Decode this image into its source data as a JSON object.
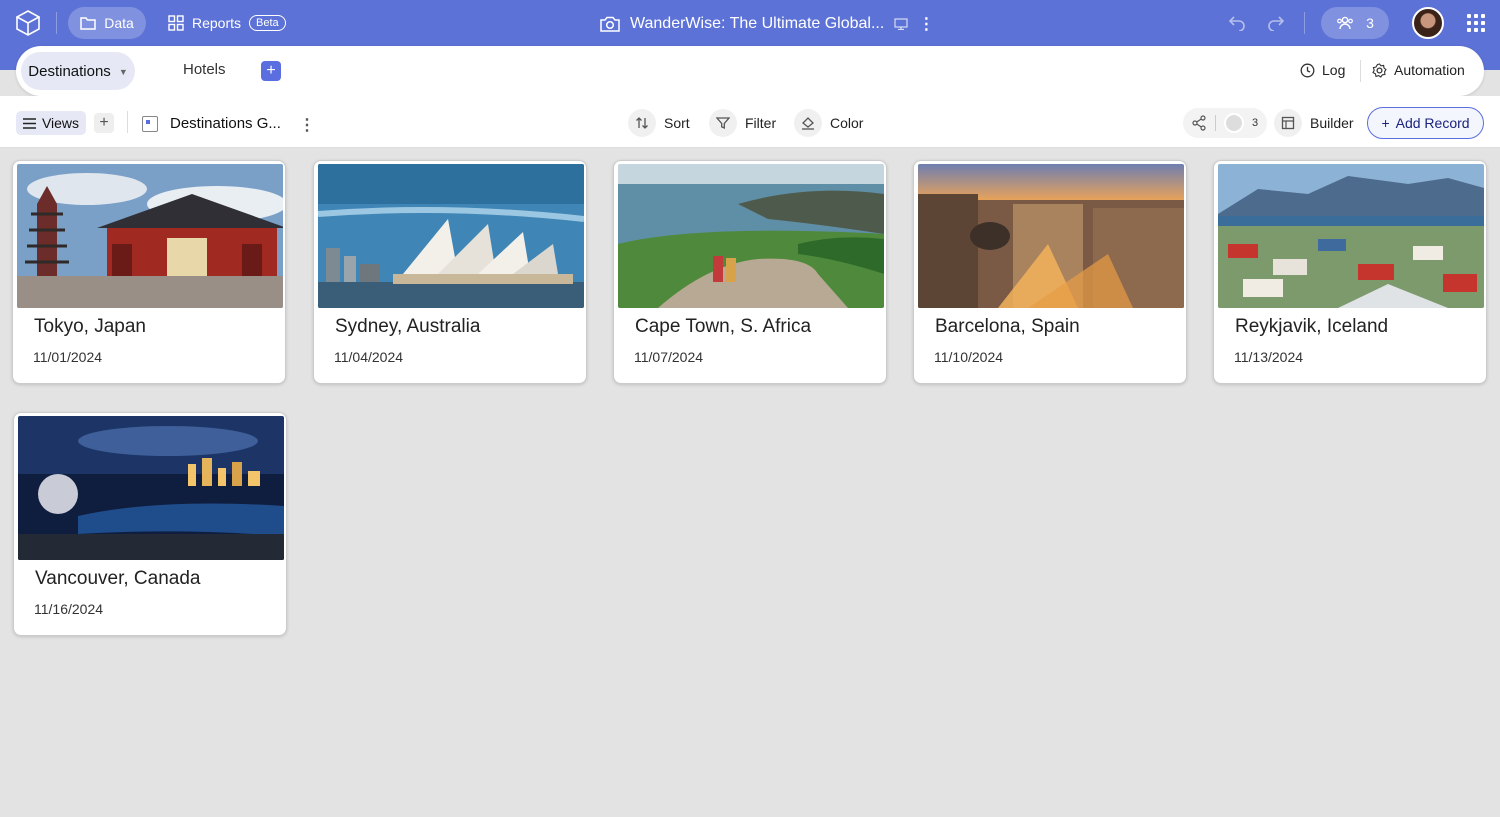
{
  "app": {
    "nav_data": "Data",
    "nav_reports": "Reports",
    "beta_badge": "Beta",
    "doc_title": "WanderWise: The Ultimate Global...",
    "collaborators_count": "3"
  },
  "tables": {
    "active": "Destinations",
    "other": "Hotels",
    "log_label": "Log",
    "automation_label": "Automation"
  },
  "toolbar": {
    "views_label": "Views",
    "view_name": "Destinations G...",
    "sort_label": "Sort",
    "filter_label": "Filter",
    "color_label": "Color",
    "shared_count": "3",
    "builder_label": "Builder",
    "add_record_label": "Add Record"
  },
  "records": [
    {
      "title": "Tokyo, Japan",
      "date": "11/01/2024",
      "image": "tokyo-temple"
    },
    {
      "title": "Sydney, Australia",
      "date": "11/04/2024",
      "image": "sydney-opera-house"
    },
    {
      "title": "Cape Town, S. Africa",
      "date": "11/07/2024",
      "image": "cape-town-coast"
    },
    {
      "title": "Barcelona, Spain",
      "date": "11/10/2024",
      "image": "barcelona-city"
    },
    {
      "title": "Reykjavik, Iceland",
      "date": "11/13/2024",
      "image": "reykjavik-town"
    },
    {
      "title": "Vancouver, Canada",
      "date": "11/16/2024",
      "image": "vancouver-night"
    }
  ],
  "colors": {
    "brand": "#5d72d6",
    "accent": "#5b6ee0",
    "background": "#e3e3e3"
  }
}
